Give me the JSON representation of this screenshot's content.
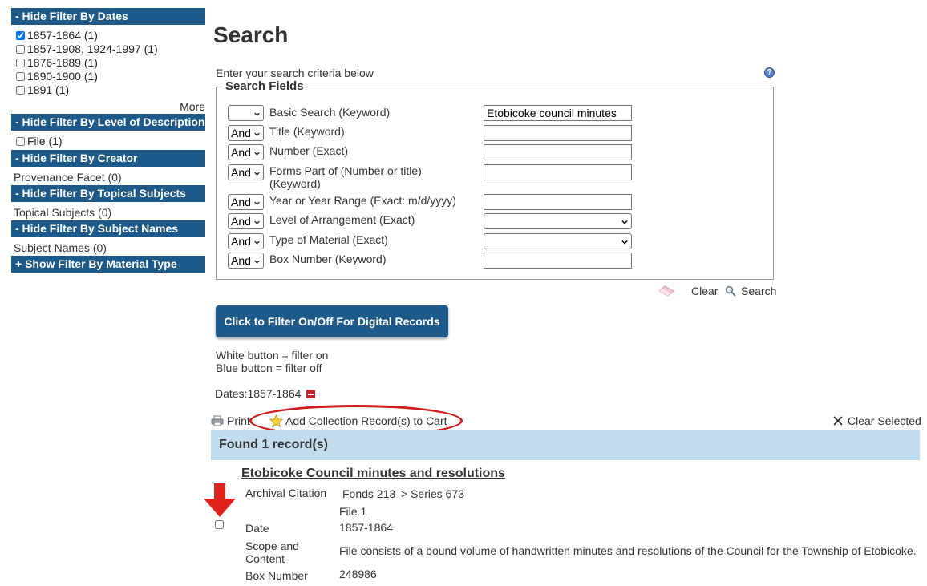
{
  "sidebar": {
    "dates_header": "- Hide Filter By Dates",
    "dates": [
      {
        "label": "1857-1864 (1)",
        "checked": true
      },
      {
        "label": "1857-1908, 1924-1997 (1)",
        "checked": false
      },
      {
        "label": "1876-1889 (1)",
        "checked": false
      },
      {
        "label": "1890-1900 (1)",
        "checked": false
      },
      {
        "label": "1891 (1)",
        "checked": false
      }
    ],
    "more_label": "More",
    "level_header": "- Hide Filter By Level of Description",
    "level_option": "File (1)",
    "creator_header": "- Hide Filter By Creator",
    "creator_facet": "Provenance Facet (0)",
    "topical_header": "- Hide Filter By Topical Subjects",
    "topical_facet": "Topical Subjects (0)",
    "names_header": "- Hide Filter By Subject Names",
    "names_facet": "Subject Names (0)",
    "material_header": "+ Show Filter By Material Type"
  },
  "search": {
    "title": "Search",
    "criteria_text": "Enter your search criteria below",
    "help_icon": "?",
    "fields_legend": "Search Fields",
    "fields": [
      {
        "op": "",
        "label": "Basic Search  (Keyword)",
        "value": "Etobicoke council minutes",
        "type": "text"
      },
      {
        "op": "And",
        "label": "Title  (Keyword)",
        "value": "",
        "type": "text"
      },
      {
        "op": "And",
        "label": "Number  (Exact)",
        "value": "",
        "type": "text"
      },
      {
        "op": "And",
        "label": "Forms Part of (Number or title) (Keyword)",
        "value": "",
        "type": "text"
      },
      {
        "op": "And",
        "label": "Year or Year Range  (Exact: m/d/yyyy)",
        "value": "",
        "type": "text"
      },
      {
        "op": "And",
        "label": "Level of Arrangement  (Exact)",
        "value": "",
        "type": "select"
      },
      {
        "op": "And",
        "label": "Type of Material  (Exact)",
        "value": "",
        "type": "select"
      },
      {
        "op": "And",
        "label": "Box Number  (Keyword)",
        "value": "",
        "type": "text"
      }
    ],
    "clear_label": "Clear",
    "search_label": "Search"
  },
  "digital_filter": {
    "button_label": "Click to Filter On/Off For Digital Records",
    "note_line1": "White button = filter on",
    "note_line2": "Blue button = filter off"
  },
  "active_filter": "Dates:1857-1864",
  "toolbar": {
    "print_label": "Print",
    "cart_label": "Add Collection Record(s) to Cart",
    "clear_selected_label": "Clear Selected"
  },
  "results": {
    "found_label": "Found 1 record(s)",
    "record": {
      "title": "Etobicoke Council minutes and resolutions",
      "citation_label": "Archival Citation",
      "citation_fonds": "Fonds 213",
      "citation_series": "> Series 673",
      "citation_file": "File 1",
      "date_label": "Date",
      "date_value": "1857-1864",
      "scope_label_1": "Scope and",
      "scope_label_2": "Content",
      "scope_value": "File consists of a bound volume of handwritten minutes and resolutions of the Council for the Township of Etobicoke.",
      "box_label": "Box Number",
      "box_value": "248986"
    }
  },
  "colors": {
    "filter_bar": "#1d5a8a",
    "found_bar": "#c2dcef",
    "annotation_red": "#d11a1a"
  }
}
